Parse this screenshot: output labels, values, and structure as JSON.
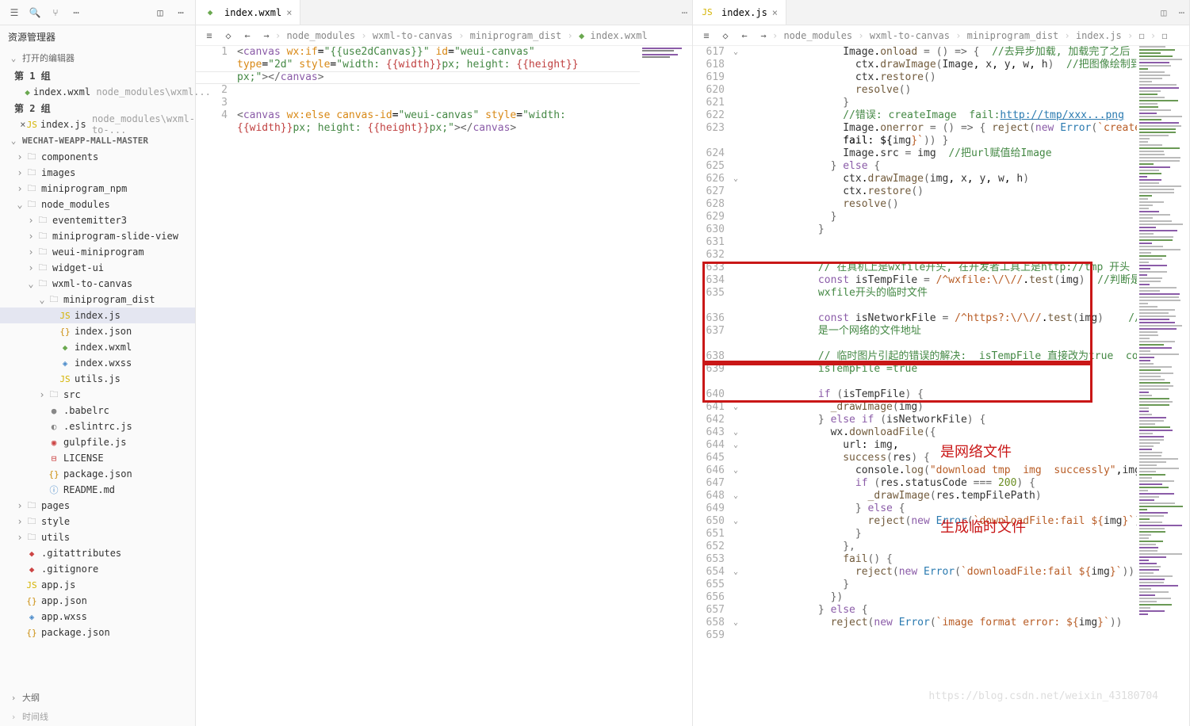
{
  "sidebar": {
    "title": "资源管理器",
    "openEditors": "打开的编辑器",
    "group1": "第 1 组",
    "group2": "第 2 组",
    "file1": {
      "name": "index.wxml",
      "dim": "node_modules\\wxml..."
    },
    "file2": {
      "name": "index.js",
      "dim": "node_modules\\wxml-to-..."
    },
    "project": "WECHAT-WEAPP-MALL-MASTER",
    "tree": [
      {
        "icon": "folder",
        "name": "components",
        "collapsed": true
      },
      {
        "icon": "folder",
        "name": "images",
        "collapsed": true
      },
      {
        "icon": "folder",
        "name": "miniprogram_npm",
        "collapsed": true
      },
      {
        "icon": "folder",
        "name": "node_modules",
        "collapsed": false,
        "children": [
          {
            "icon": "folder",
            "name": "eventemitter3",
            "collapsed": true
          },
          {
            "icon": "folder",
            "name": "miniprogram-slide-view",
            "collapsed": true
          },
          {
            "icon": "folder",
            "name": "weui-miniprogram",
            "collapsed": true
          },
          {
            "icon": "folder",
            "name": "widget-ui",
            "collapsed": true
          },
          {
            "icon": "folder",
            "name": "wxml-to-canvas",
            "collapsed": false,
            "children": [
              {
                "icon": "folder",
                "name": "miniprogram_dist",
                "collapsed": false,
                "children": [
                  {
                    "icon": "js",
                    "name": "index.js",
                    "sel": true
                  },
                  {
                    "icon": "json",
                    "name": "index.json"
                  },
                  {
                    "icon": "wxml",
                    "name": "index.wxml"
                  },
                  {
                    "icon": "wxss",
                    "name": "index.wxss"
                  },
                  {
                    "icon": "js",
                    "name": "utils.js"
                  }
                ]
              },
              {
                "icon": "folder",
                "name": "src",
                "collapsed": true
              },
              {
                "icon": "babel",
                "name": ".babelrc"
              },
              {
                "icon": "eslint",
                "name": ".eslintrc.js"
              },
              {
                "icon": "gulp",
                "name": "gulpfile.js"
              },
              {
                "icon": "license",
                "name": "LICENSE"
              },
              {
                "icon": "json",
                "name": "package.json"
              },
              {
                "icon": "readme",
                "name": "README.md"
              }
            ]
          }
        ]
      },
      {
        "icon": "folder",
        "name": "pages",
        "collapsed": true
      },
      {
        "icon": "folder",
        "name": "style",
        "collapsed": true
      },
      {
        "icon": "folder",
        "name": "utils",
        "collapsed": true
      },
      {
        "icon": "git",
        "name": ".gitattributes"
      },
      {
        "icon": "git",
        "name": ".gitignore"
      },
      {
        "icon": "js",
        "name": "app.js"
      },
      {
        "icon": "json",
        "name": "app.json"
      },
      {
        "icon": "wxss",
        "name": "app.wxss"
      },
      {
        "icon": "json",
        "name": "package.json"
      }
    ],
    "outline": "大纲",
    "timeline": "时间线"
  },
  "pane1": {
    "tab": "index.wxml",
    "crumbs": [
      "node_modules",
      "wxml-to-canvas",
      "miniprogram_dist",
      "index.wxml"
    ],
    "lines": [
      1,
      2,
      3,
      4
    ]
  },
  "pane2": {
    "tab": "index.js",
    "crumbs": [
      "node_modules",
      "wxml-to-canvas",
      "miniprogram_dist",
      "index.js",
      "<function>"
    ],
    "lines": [
      617,
      618,
      619,
      620,
      621,
      622,
      623,
      624,
      625,
      626,
      627,
      628,
      629,
      630,
      631,
      632,
      633,
      634,
      635,
      636,
      637,
      638,
      639,
      640,
      641,
      642,
      643,
      644,
      645,
      646,
      647,
      648,
      649,
      650,
      651,
      652,
      653,
      654,
      655,
      656,
      657,
      658,
      659
    ],
    "annot1": "是网络文件",
    "annot2": "生成临时文件"
  },
  "watermark": "https://blog.csdn.net/weixin_43180704"
}
